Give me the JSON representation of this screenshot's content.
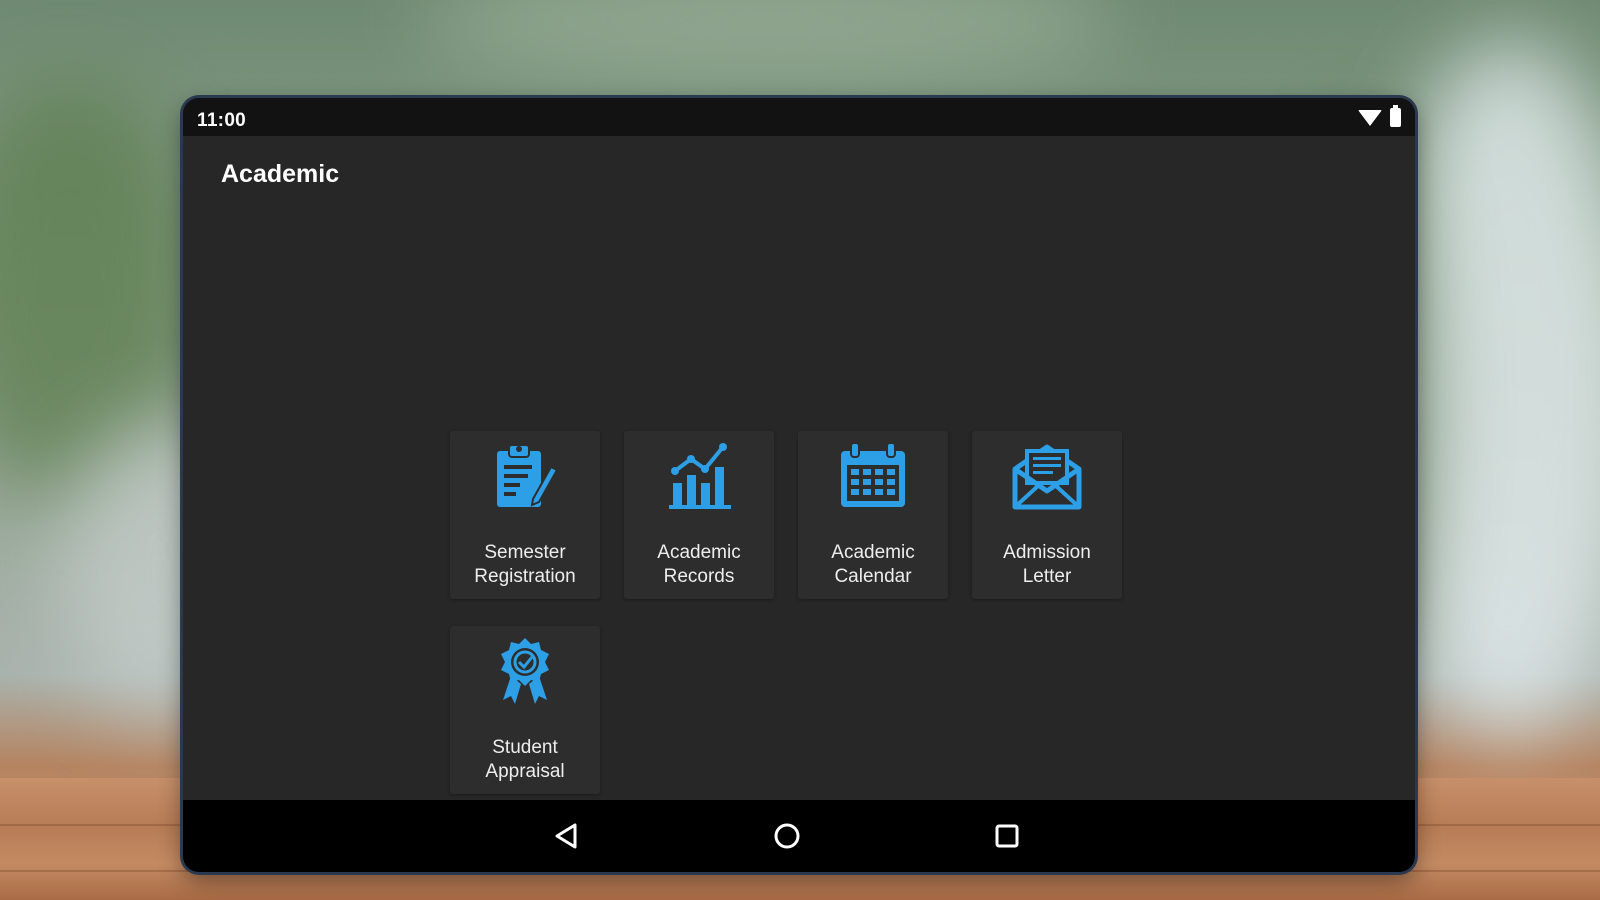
{
  "status_bar": {
    "time": "11:00"
  },
  "app_bar": {
    "title": "Academic"
  },
  "tiles": [
    {
      "label": "Semester\nRegistration",
      "icon": "clipboard-pen-icon"
    },
    {
      "label": "Academic\nRecords",
      "icon": "bar-chart-trend-icon"
    },
    {
      "label": "Academic\nCalendar",
      "icon": "calendar-icon"
    },
    {
      "label": "Admission\nLetter",
      "icon": "envelope-letter-icon"
    },
    {
      "label": "Student\nAppraisal",
      "icon": "award-badge-icon"
    }
  ],
  "colors": {
    "accent": "#2d9fe6",
    "surface": "#272727",
    "tile": "#2d2d2d"
  }
}
